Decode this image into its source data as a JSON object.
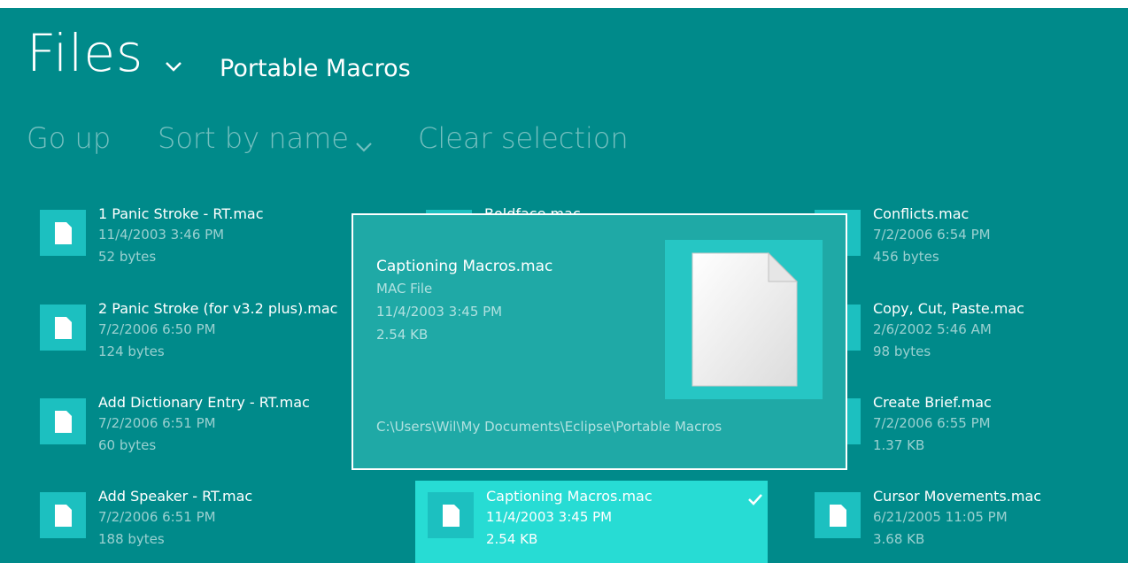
{
  "header": {
    "title": "Files",
    "location": "Portable Macros"
  },
  "commands": {
    "go_up": "Go up",
    "sort": "Sort by name",
    "clear": "Clear selection"
  },
  "files": {
    "col1": [
      {
        "name": "1 Panic Stroke - RT.mac",
        "date": "11/4/2003 3:46 PM",
        "size": "52 bytes"
      },
      {
        "name": "2 Panic Stroke (for v3.2 plus).mac",
        "date": "7/2/2006 6:50 PM",
        "size": "124 bytes"
      },
      {
        "name": "Add Dictionary Entry - RT.mac",
        "date": "7/2/2006 6:51 PM",
        "size": "60 bytes"
      },
      {
        "name": "Add Speaker - RT.mac",
        "date": "7/2/2006 6:51 PM",
        "size": "188 bytes"
      }
    ],
    "col2_partial": "Boldface.mac",
    "selected": {
      "name": "Captioning Macros.mac",
      "date": "11/4/2003 3:45 PM",
      "size": "2.54 KB"
    },
    "col3": [
      {
        "name": "Conflicts.mac",
        "date": "7/2/2006 6:54 PM",
        "size": "456 bytes"
      },
      {
        "name": "Copy, Cut, Paste.mac",
        "date": "2/6/2002 5:46 AM",
        "size": "98 bytes"
      },
      {
        "name": "Create Brief.mac",
        "date": "7/2/2006 6:55 PM",
        "size": "1.37 KB"
      },
      {
        "name": "Cursor Movements.mac",
        "date": "6/21/2005 11:05 PM",
        "size": "3.68 KB"
      }
    ]
  },
  "tooltip": {
    "name": "Captioning Macros.mac",
    "type": "MAC File",
    "date": "11/4/2003 3:45 PM",
    "size": "2.54 KB",
    "path": "C:\\Users\\Wil\\My Documents\\Eclipse\\Portable Macros"
  },
  "colors": {
    "background": "#008a8a",
    "tile": "#1cc0c0",
    "selected": "#27dcd4",
    "popup": "#1fa9a6"
  }
}
